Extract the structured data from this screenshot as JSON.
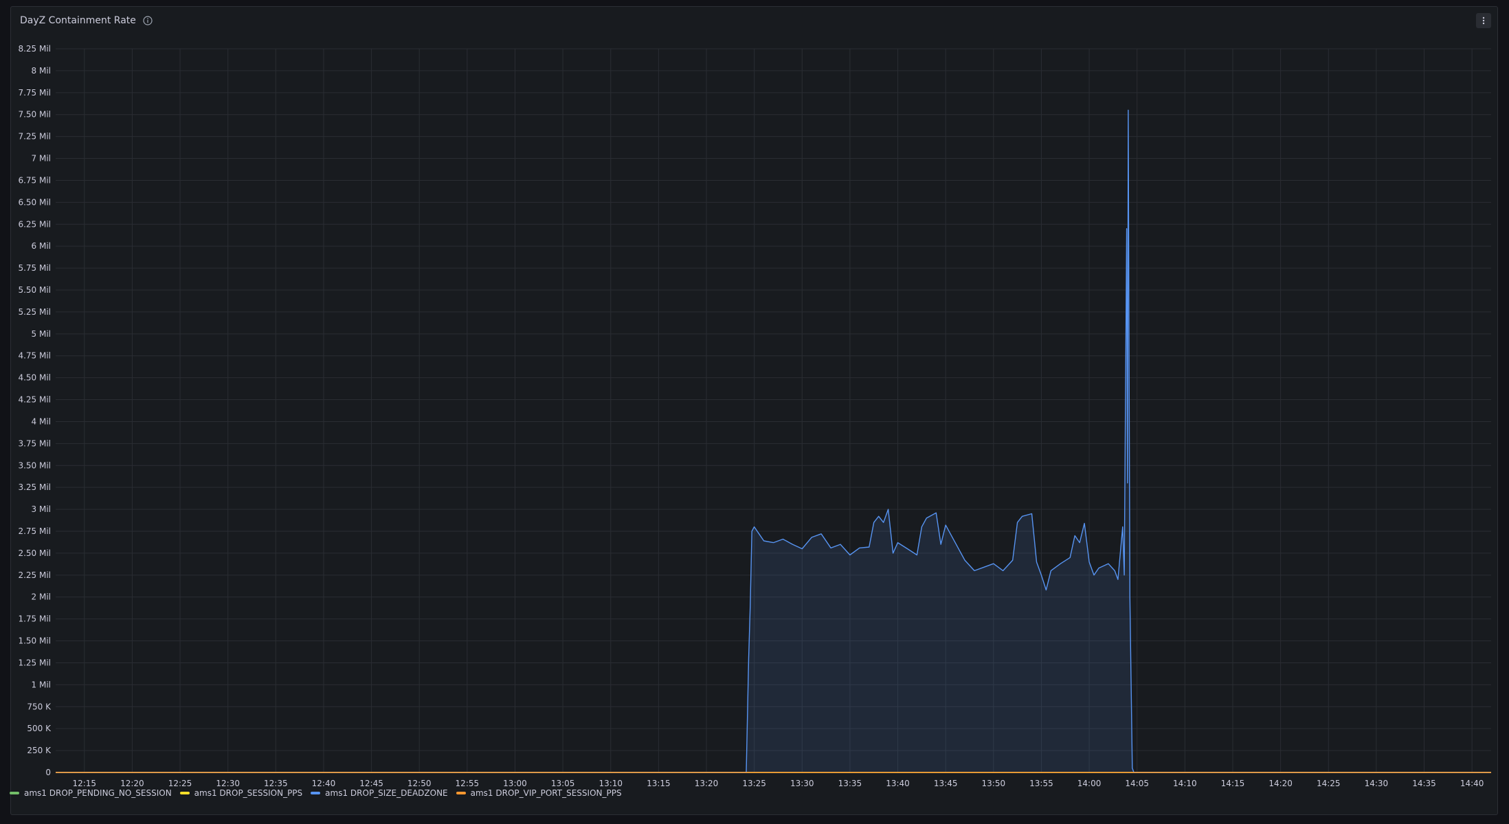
{
  "panel": {
    "title": "DayZ Containment Rate",
    "info_icon": "info-icon",
    "menu_icon": "vertical-dots-icon"
  },
  "colors": {
    "background": "#111217",
    "panel": "#181b1f",
    "grid": "#2a2d33",
    "axis_text": "#ccccdc",
    "series_green": "#73bf69",
    "series_yellow": "#fade2a",
    "series_blue": "#5794f2",
    "series_orange": "#ff9830"
  },
  "chart_data": {
    "type": "area",
    "title": "DayZ Containment Rate",
    "xlabel": "",
    "ylabel": "",
    "ylim": [
      0,
      8250000
    ],
    "y_ticks": [
      "0",
      "250 K",
      "500 K",
      "750 K",
      "1 Mil",
      "1.25 Mil",
      "1.50 Mil",
      "1.75 Mil",
      "2 Mil",
      "2.25 Mil",
      "2.50 Mil",
      "2.75 Mil",
      "3 Mil",
      "3.25 Mil",
      "3.50 Mil",
      "3.75 Mil",
      "4 Mil",
      "4.25 Mil",
      "4.50 Mil",
      "4.75 Mil",
      "5 Mil",
      "5.25 Mil",
      "5.50 Mil",
      "5.75 Mil",
      "6 Mil",
      "6.25 Mil",
      "6.50 Mil",
      "6.75 Mil",
      "7 Mil",
      "7.25 Mil",
      "7.50 Mil",
      "7.75 Mil",
      "8 Mil",
      "8.25 Mil"
    ],
    "x_ticks": [
      "12:15",
      "12:20",
      "12:25",
      "12:30",
      "12:35",
      "12:40",
      "12:45",
      "12:50",
      "12:55",
      "13:00",
      "13:05",
      "13:10",
      "13:15",
      "13:20",
      "13:25",
      "13:30",
      "13:35",
      "13:40",
      "13:45",
      "13:50",
      "13:55",
      "14:00",
      "14:05",
      "14:10",
      "14:15",
      "14:20",
      "14:25",
      "14:30",
      "14:35",
      "14:40"
    ],
    "xlim": [
      "12:12",
      "14:42"
    ],
    "grid": true,
    "legend_position": "bottom-left",
    "series": [
      {
        "name": "ams1 DROP_PENDING_NO_SESSION",
        "color": "#73bf69",
        "points": [
          [
            "12:12",
            0
          ],
          [
            "14:42",
            0
          ]
        ]
      },
      {
        "name": "ams1 DROP_SESSION_PPS",
        "color": "#fade2a",
        "points": [
          [
            "12:12",
            0
          ],
          [
            "14:42",
            0
          ]
        ]
      },
      {
        "name": "ams1 DROP_SIZE_DEADZONE",
        "color": "#5794f2",
        "fill": true,
        "points": [
          [
            "12:12",
            0
          ],
          [
            "13:24:10",
            0
          ],
          [
            "13:24:25",
            1300000
          ],
          [
            "13:24:35",
            1900000
          ],
          [
            "13:24:45",
            2750000
          ],
          [
            "13:25:00",
            2800000
          ],
          [
            "13:25:30",
            2720000
          ],
          [
            "13:26:00",
            2640000
          ],
          [
            "13:27:00",
            2620000
          ],
          [
            "13:28:00",
            2660000
          ],
          [
            "13:29:00",
            2600000
          ],
          [
            "13:30:00",
            2550000
          ],
          [
            "13:31:00",
            2680000
          ],
          [
            "13:32:00",
            2720000
          ],
          [
            "13:33:00",
            2560000
          ],
          [
            "13:34:00",
            2600000
          ],
          [
            "13:35:00",
            2480000
          ],
          [
            "13:36:00",
            2560000
          ],
          [
            "13:37:00",
            2570000
          ],
          [
            "13:37:30",
            2850000
          ],
          [
            "13:38:00",
            2920000
          ],
          [
            "13:38:30",
            2850000
          ],
          [
            "13:39:00",
            3000000
          ],
          [
            "13:39:30",
            2500000
          ],
          [
            "13:40:00",
            2620000
          ],
          [
            "13:41:00",
            2550000
          ],
          [
            "13:42:00",
            2480000
          ],
          [
            "13:42:30",
            2800000
          ],
          [
            "13:43:00",
            2900000
          ],
          [
            "13:44:00",
            2960000
          ],
          [
            "13:44:30",
            2600000
          ],
          [
            "13:45:00",
            2820000
          ],
          [
            "13:46:00",
            2620000
          ],
          [
            "13:47:00",
            2420000
          ],
          [
            "13:48:00",
            2300000
          ],
          [
            "13:49:00",
            2340000
          ],
          [
            "13:50:00",
            2380000
          ],
          [
            "13:51:00",
            2300000
          ],
          [
            "13:52:00",
            2420000
          ],
          [
            "13:52:30",
            2850000
          ],
          [
            "13:53:00",
            2920000
          ],
          [
            "13:54:00",
            2950000
          ],
          [
            "13:54:30",
            2400000
          ],
          [
            "13:55:00",
            2250000
          ],
          [
            "13:55:30",
            2080000
          ],
          [
            "13:56:00",
            2300000
          ],
          [
            "13:57:00",
            2380000
          ],
          [
            "13:58:00",
            2450000
          ],
          [
            "13:58:30",
            2700000
          ],
          [
            "13:59:00",
            2620000
          ],
          [
            "13:59:30",
            2840000
          ],
          [
            "14:00:00",
            2400000
          ],
          [
            "14:00:30",
            2250000
          ],
          [
            "14:01:00",
            2330000
          ],
          [
            "14:02:00",
            2380000
          ],
          [
            "14:02:40",
            2300000
          ],
          [
            "14:03:00",
            2200000
          ],
          [
            "14:03:30",
            2800000
          ],
          [
            "14:03:40",
            2250000
          ],
          [
            "14:03:55",
            6200000
          ],
          [
            "14:04:00",
            3300000
          ],
          [
            "14:04:05",
            7550000
          ],
          [
            "14:04:15",
            2000000
          ],
          [
            "14:04:30",
            50000
          ],
          [
            "14:04:40",
            0
          ],
          [
            "14:42",
            0
          ]
        ]
      },
      {
        "name": "ams1 DROP_VIP_PORT_SESSION_PPS",
        "color": "#ff9830",
        "points": [
          [
            "12:12",
            0
          ],
          [
            "14:42",
            0
          ]
        ]
      }
    ]
  }
}
